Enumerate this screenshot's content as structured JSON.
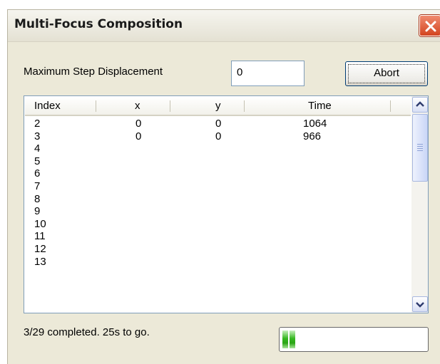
{
  "window": {
    "title": "Multi-Focus Composition",
    "close_icon": "close-icon"
  },
  "settings": {
    "max_step_label": "Maximum Step Displacement",
    "max_step_value": "0",
    "abort_label": "Abort"
  },
  "table": {
    "headers": [
      "Index",
      "x",
      "y",
      "Time"
    ],
    "rows": [
      {
        "index": "2",
        "x": "0",
        "y": "0",
        "time": "1064"
      },
      {
        "index": "3",
        "x": "0",
        "y": "0",
        "time": "966"
      },
      {
        "index": "4",
        "x": "",
        "y": "",
        "time": ""
      },
      {
        "index": "5",
        "x": "",
        "y": "",
        "time": ""
      },
      {
        "index": "6",
        "x": "",
        "y": "",
        "time": ""
      },
      {
        "index": "7",
        "x": "",
        "y": "",
        "time": ""
      },
      {
        "index": "8",
        "x": "",
        "y": "",
        "time": ""
      },
      {
        "index": "9",
        "x": "",
        "y": "",
        "time": ""
      },
      {
        "index": "10",
        "x": "",
        "y": "",
        "time": ""
      },
      {
        "index": "11",
        "x": "",
        "y": "",
        "time": ""
      },
      {
        "index": "12",
        "x": "",
        "y": "",
        "time": ""
      },
      {
        "index": "13",
        "x": "",
        "y": "",
        "time": ""
      }
    ]
  },
  "status": {
    "text": "3/29 completed. 25s to go.",
    "progress_fraction": 0.103
  },
  "colors": {
    "titlebar_close": "#d3441f",
    "progress_green": "#35b720",
    "dialog_bg": "#ece9d8"
  }
}
